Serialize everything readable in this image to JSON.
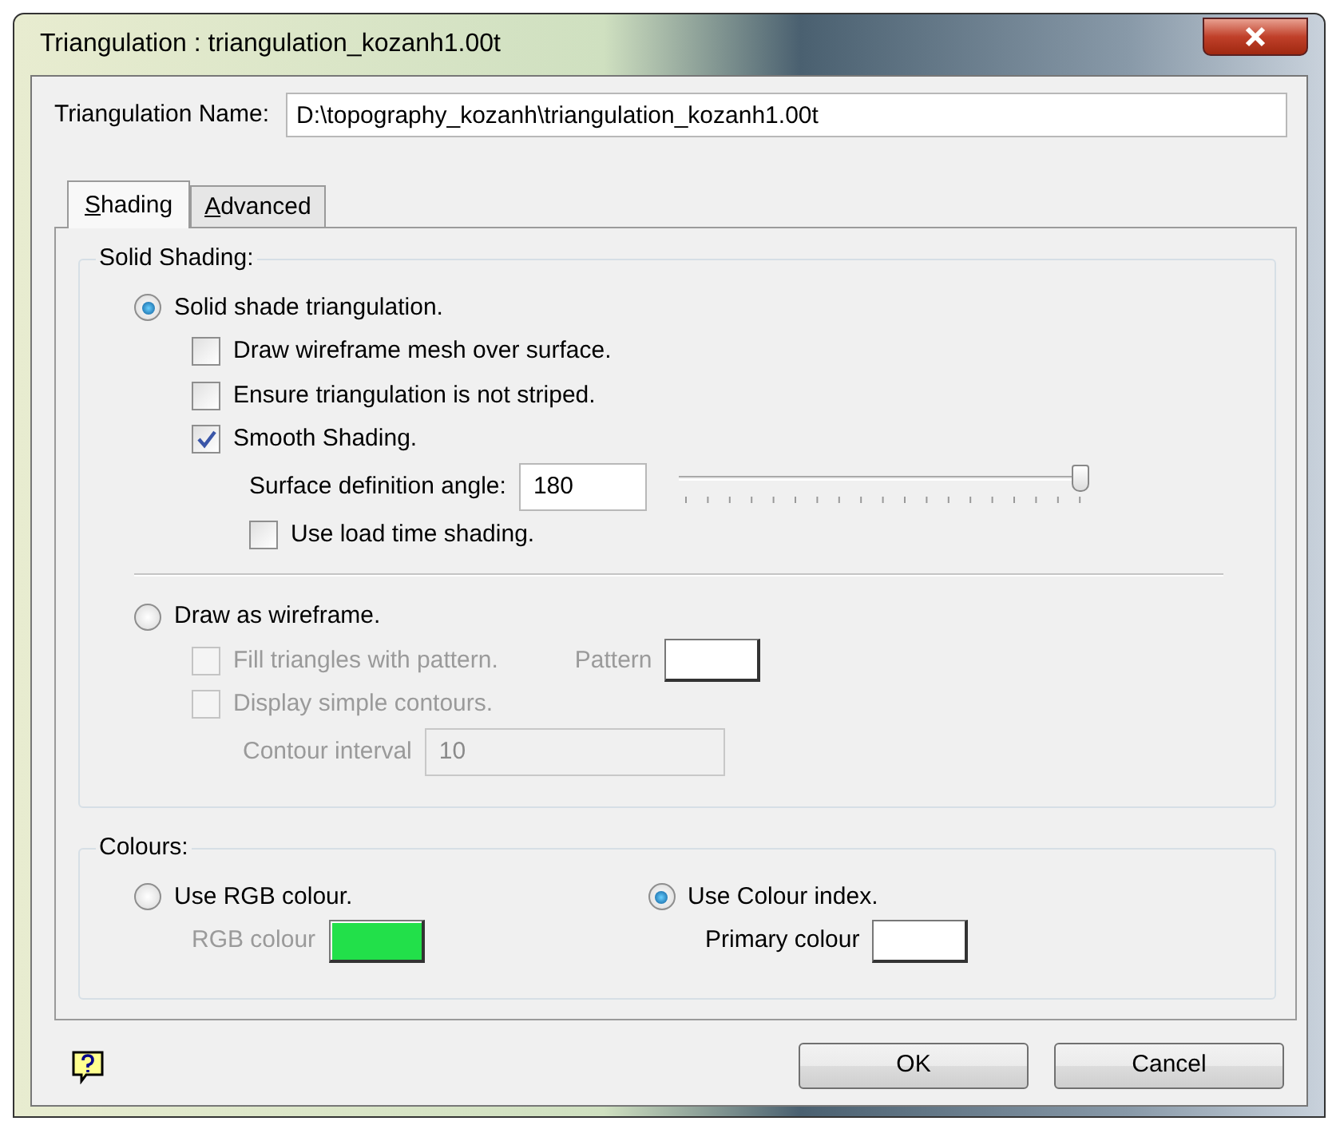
{
  "window": {
    "title": "Triangulation :  triangulation_kozanh1.00t"
  },
  "name_field": {
    "label": "Triangulation Name:",
    "value": "D:\\topography_kozanh\\triangulation_kozanh1.00t"
  },
  "tabs": [
    {
      "label": "Shading",
      "selected": true
    },
    {
      "label": "Advanced",
      "selected": false
    }
  ],
  "solid_shading": {
    "title": "Solid Shading:",
    "radio": {
      "label": "Solid shade triangulation.",
      "selected": true
    },
    "checks": [
      {
        "label": "Draw wireframe mesh over surface.",
        "checked": false,
        "disabled": false
      },
      {
        "label": "Ensure triangulation is not striped.",
        "checked": false,
        "disabled": false
      },
      {
        "label": "Smooth Shading.",
        "checked": true,
        "disabled": false
      }
    ],
    "angle": {
      "label": "Surface definition angle:",
      "value": "180",
      "level": 1
    },
    "load_time": {
      "label": "Use load time shading.",
      "checked": false,
      "disabled": false
    },
    "wire_radio": {
      "label": "Draw as wireframe.",
      "selected": false
    },
    "fill_pattern": {
      "label": "Fill triangles with pattern.",
      "checked": false,
      "disabled": true,
      "swatch_label": "Pattern",
      "color": "#ffffff"
    },
    "contours": {
      "label": "Display simple contours.",
      "checked": false,
      "disabled": true
    },
    "interval": {
      "label": "Contour interval",
      "value": "10",
      "disabled": true
    }
  },
  "colours": {
    "title": "Colours:",
    "options": [
      {
        "label": "Use RGB colour.",
        "selected": false,
        "swatch_label": "RGB colour",
        "color": "#22e04a",
        "disabled": true
      },
      {
        "label": "Use Colour index.",
        "selected": true,
        "swatch_label": "Primary colour",
        "color": "#ffffff",
        "disabled": false
      }
    ]
  },
  "buttons": [
    {
      "label": "OK"
    },
    {
      "label": "Cancel"
    }
  ]
}
